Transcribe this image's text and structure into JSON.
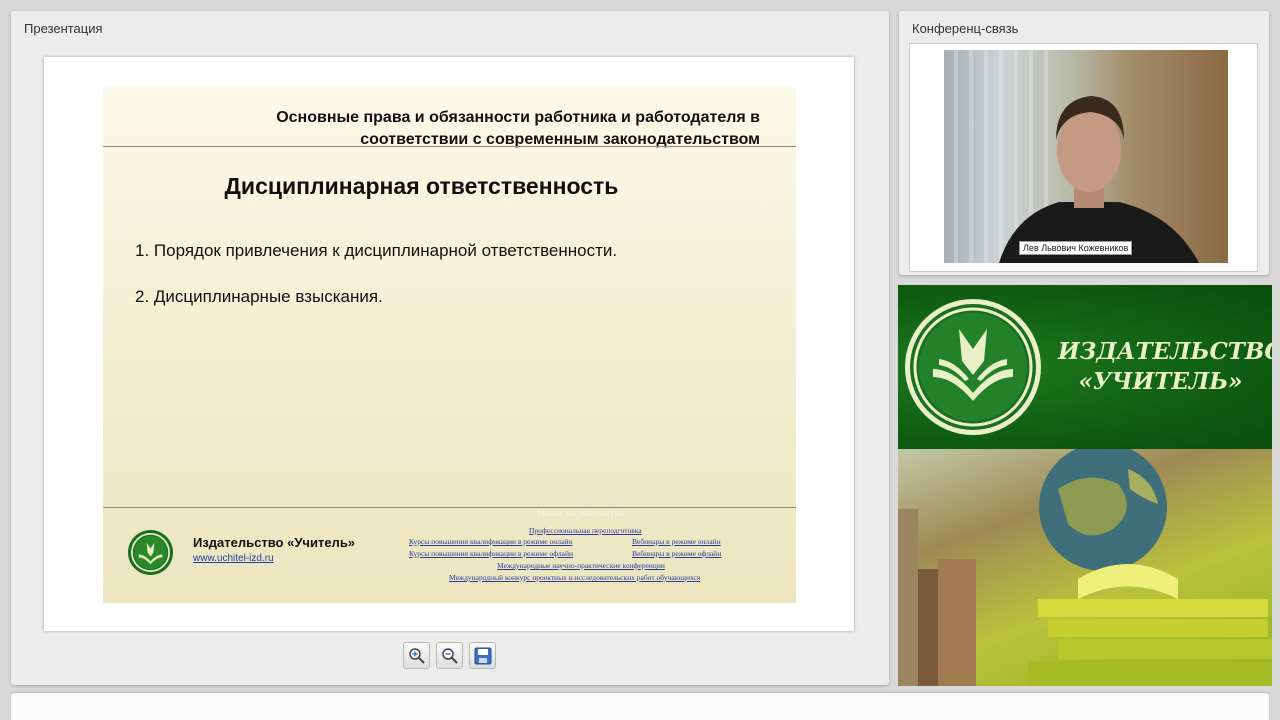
{
  "presentation": {
    "panel_title": "Презентация",
    "slide": {
      "header": "Основные права и обязанности работника и работодателя в соответствии с современным законодательством",
      "title": "Дисциплинарная ответственность",
      "items": [
        "1. Порядок привлечения к дисциплинарной ответственности.",
        "2. Дисциплинарные взыскания."
      ],
      "footer": {
        "publisher_name": "Издательство «Учитель»",
        "publisher_url": "www.uchitel-izd.ru",
        "events_title": "Наши мероприятия",
        "links": [
          "Профессиональная переподготовка",
          "Курсы повышения квалификации в режиме онлайн",
          "Вебинары в режиме онлайн",
          "Курсы повышения квалификации в режиме офлайн",
          "Вебинары в режиме офлайн",
          "Международные научно-практические конференции",
          "Международный конкурс проектных и исследовательских работ обучающихся"
        ]
      }
    },
    "toolbar": {
      "zoom_in_icon": "zoom-in-icon",
      "zoom_out_icon": "zoom-out-icon",
      "save_icon": "save-icon"
    }
  },
  "conference": {
    "panel_title": "Конференц-связь",
    "speaker_name": "Лев Львович Кожевников"
  },
  "banner": {
    "line1": "ИЗДАТЕЛЬСТВО",
    "line2": "«УЧИТЕЛЬ»"
  },
  "colors": {
    "banner_green": "#0f5e12",
    "banner_text": "#e9f0c8",
    "link_blue": "#2a3a9a"
  }
}
